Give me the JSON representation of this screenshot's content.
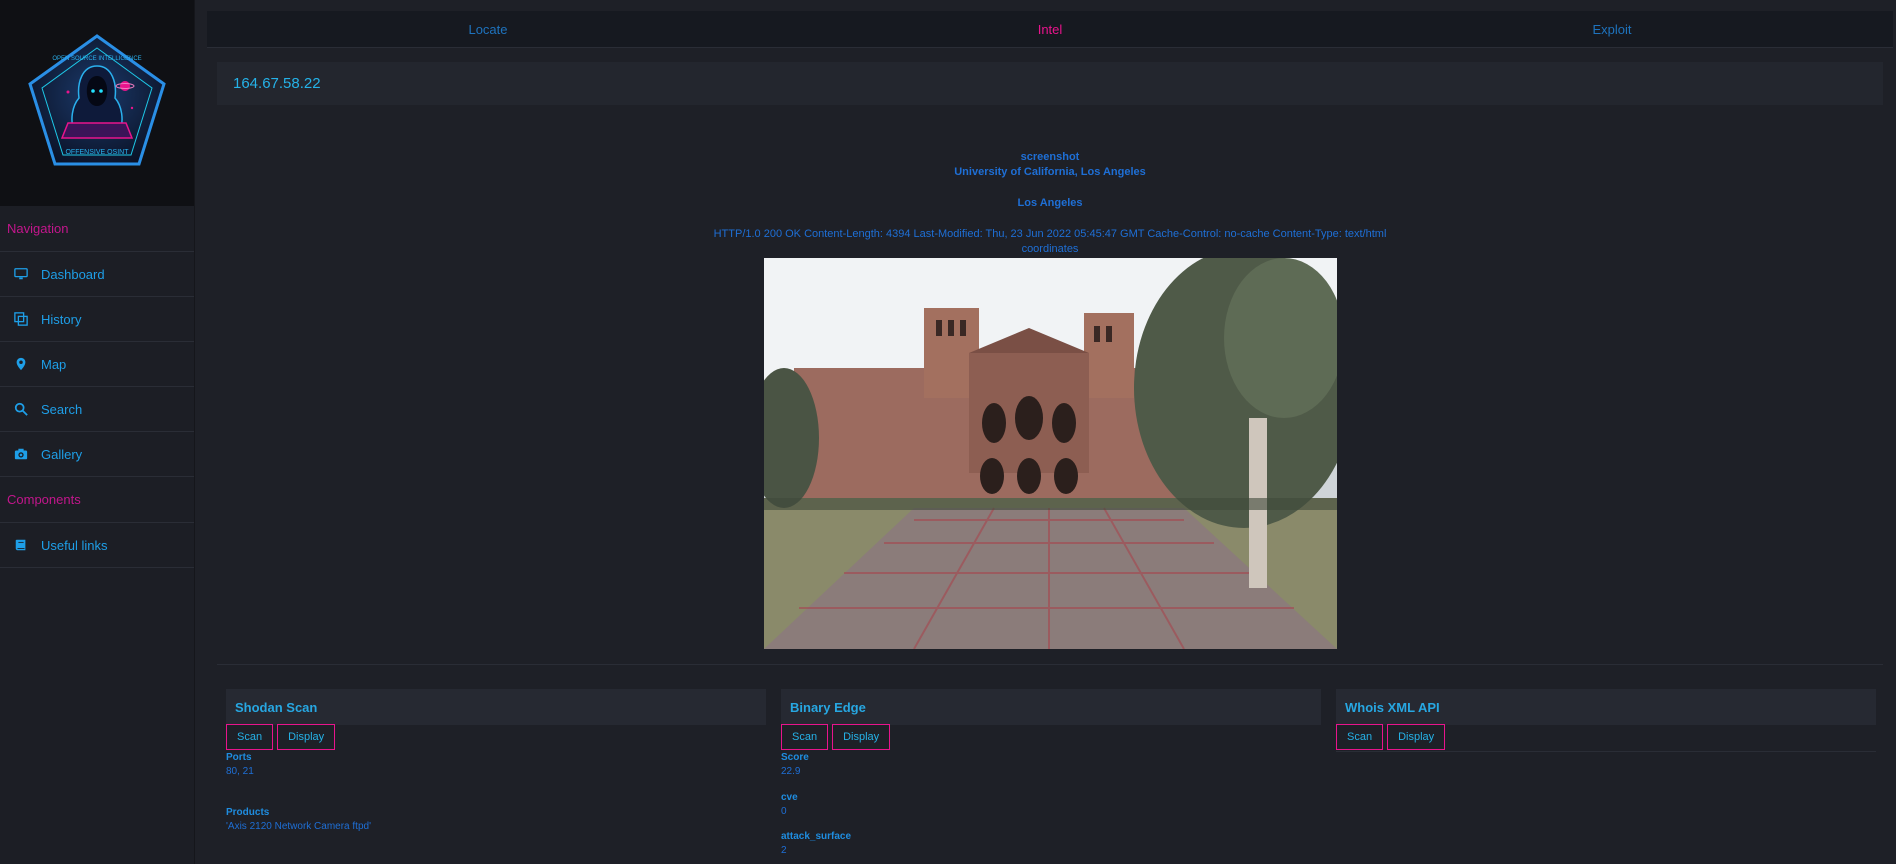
{
  "logo": {
    "top_text": "OPEN SOURCE INTELLIGENCE",
    "bottom_text": "OFFENSIVE OSINT"
  },
  "sidebar": {
    "navigation_title": "Navigation",
    "nav_items": [
      {
        "label": "Dashboard",
        "icon": "monitor-icon"
      },
      {
        "label": "History",
        "icon": "history-icon"
      },
      {
        "label": "Map",
        "icon": "pin-icon"
      },
      {
        "label": "Search",
        "icon": "search-icon"
      },
      {
        "label": "Gallery",
        "icon": "camera-icon"
      }
    ],
    "components_title": "Components",
    "component_items": [
      {
        "label": "Useful links",
        "icon": "book-icon"
      }
    ]
  },
  "tabs": [
    {
      "label": "Locate",
      "active": false
    },
    {
      "label": "Intel",
      "active": true
    },
    {
      "label": "Exploit",
      "active": false
    }
  ],
  "ip": "164.67.58.22",
  "info": {
    "screenshot_label": "screenshot",
    "organization": "University of California, Los Angeles",
    "city": "Los Angeles",
    "http_header": "HTTP/1.0 200 OK Content-Length: 4394 Last-Modified: Thu, 23 Jun 2022 05:45:47 GMT Cache-Control: no-cache Content-Type: text/html",
    "coordinates_label": "coordinates"
  },
  "panels": {
    "shodan": {
      "title": "Shodan Scan",
      "scan_label": "Scan",
      "display_label": "Display",
      "fields": [
        {
          "key": "Ports",
          "value": "80, 21"
        },
        {
          "key": "Products",
          "value": "'Axis 2120 Network Camera ftpd'"
        }
      ]
    },
    "binaryedge": {
      "title": "Binary Edge",
      "scan_label": "Scan",
      "display_label": "Display",
      "fields": [
        {
          "key": "Score",
          "value": "22.9"
        },
        {
          "key": "cve",
          "value": "0"
        },
        {
          "key": "attack_surface",
          "value": "2"
        }
      ]
    },
    "whois": {
      "title": "Whois XML API",
      "scan_label": "Scan",
      "display_label": "Display"
    }
  },
  "colors": {
    "accent_magenta": "#e8148c",
    "accent_blue": "#25b2e8",
    "background": "#1e2027"
  }
}
